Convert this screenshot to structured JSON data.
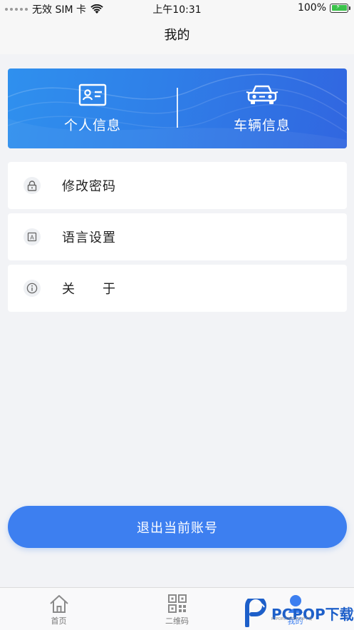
{
  "status_bar": {
    "carrier": "无效 SIM 卡",
    "time": "上午10:31",
    "battery": "100%"
  },
  "nav": {
    "title": "我的"
  },
  "banner": {
    "personal_info": "个人信息",
    "vehicle_info": "车辆信息"
  },
  "menu": [
    {
      "label": "修改密码",
      "icon": "lock-icon"
    },
    {
      "label": "语言设置",
      "icon": "language-icon"
    },
    {
      "label": "关　　于",
      "icon": "info-icon"
    }
  ],
  "logout_label": "退出当前账号",
  "tabs": [
    {
      "label": "首页",
      "icon": "home-icon",
      "active": false
    },
    {
      "label": "二维码",
      "icon": "qrcode-icon",
      "active": false
    },
    {
      "label": "我的",
      "icon": "profile-icon",
      "active": true
    }
  ],
  "watermark": {
    "text": "PCPOP下载",
    "sub": "PCPOP.COM·PCPOP下载"
  },
  "colors": {
    "accent": "#3d7ff0",
    "banner_start": "#2f90ee",
    "banner_end": "#3166e0",
    "background": "#f2f3f6"
  }
}
